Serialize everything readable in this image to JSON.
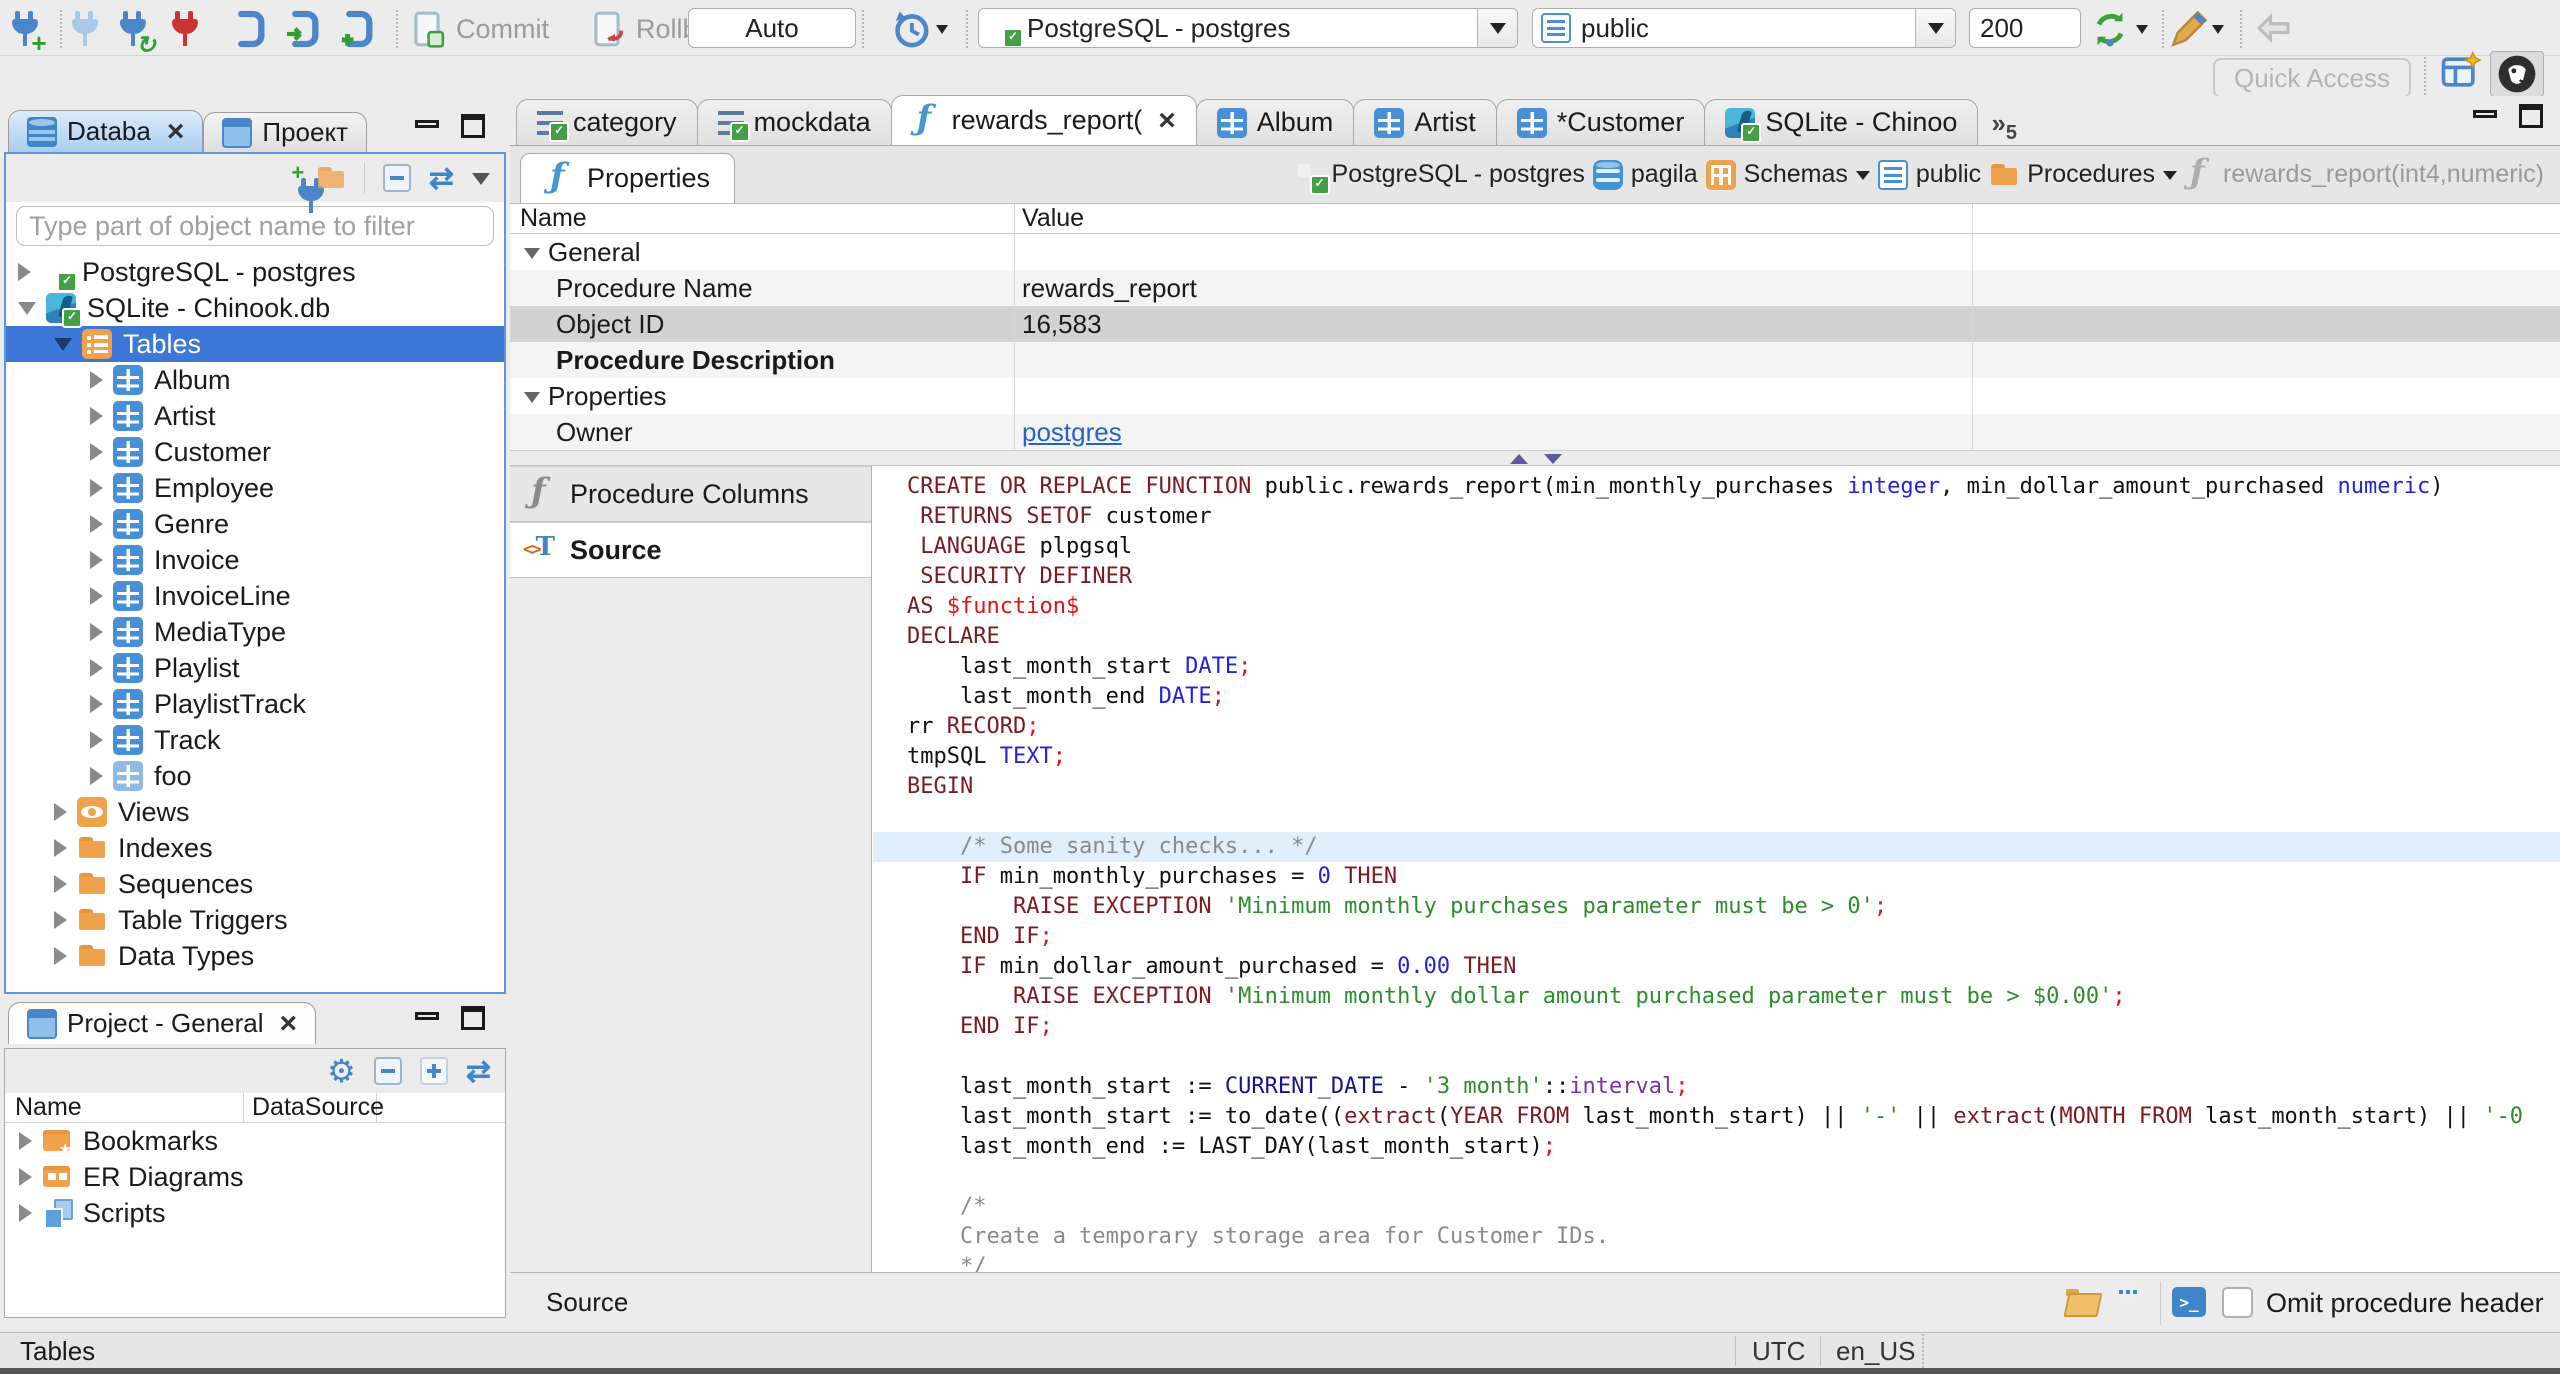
{
  "toolbar": {
    "commit": "Commit",
    "rollback": "Rollback",
    "auto": "Auto",
    "connection": "PostgreSQL - postgres",
    "schema": "public",
    "fetch_size": "200",
    "quick_access": "Quick Access"
  },
  "navigator": {
    "tab_database": "Databa",
    "tab_project": "Проект",
    "filter_placeholder": "Type part of object name to filter",
    "tree": [
      {
        "label": "PostgreSQL - postgres",
        "icon": "pg",
        "level": 0,
        "tw": "r"
      },
      {
        "label": "SQLite - Chinook.db",
        "icon": "sqlite",
        "level": 0,
        "tw": "d"
      },
      {
        "label": "Tables",
        "icon": "tables",
        "level": 1,
        "tw": "d",
        "sel": true
      },
      {
        "label": "Album",
        "icon": "table",
        "level": 2,
        "tw": "r"
      },
      {
        "label": "Artist",
        "icon": "table",
        "level": 2,
        "tw": "r"
      },
      {
        "label": "Customer",
        "icon": "table",
        "level": 2,
        "tw": "r"
      },
      {
        "label": "Employee",
        "icon": "table",
        "level": 2,
        "tw": "r"
      },
      {
        "label": "Genre",
        "icon": "table",
        "level": 2,
        "tw": "r"
      },
      {
        "label": "Invoice",
        "icon": "table",
        "level": 2,
        "tw": "r"
      },
      {
        "label": "InvoiceLine",
        "icon": "table",
        "level": 2,
        "tw": "r"
      },
      {
        "label": "MediaType",
        "icon": "table",
        "level": 2,
        "tw": "r"
      },
      {
        "label": "Playlist",
        "icon": "table",
        "level": 2,
        "tw": "r"
      },
      {
        "label": "PlaylistTrack",
        "icon": "table",
        "level": 2,
        "tw": "r"
      },
      {
        "label": "Track",
        "icon": "table",
        "level": 2,
        "tw": "r"
      },
      {
        "label": "foo",
        "icon": "table-light",
        "level": 2,
        "tw": "r"
      },
      {
        "label": "Views",
        "icon": "eye",
        "level": 1,
        "tw": "r"
      },
      {
        "label": "Indexes",
        "icon": "folder",
        "level": 1,
        "tw": "r"
      },
      {
        "label": "Sequences",
        "icon": "folder",
        "level": 1,
        "tw": "r"
      },
      {
        "label": "Table Triggers",
        "icon": "folder",
        "level": 1,
        "tw": "r"
      },
      {
        "label": "Data Types",
        "icon": "folder",
        "level": 1,
        "tw": "r"
      }
    ]
  },
  "project": {
    "tab": "Project - General",
    "col_name": "Name",
    "col_datasource": "DataSource",
    "tree": [
      {
        "label": "Bookmarks",
        "icon": "bookmarks"
      },
      {
        "label": "ER Diagrams",
        "icon": "erd"
      },
      {
        "label": "Scripts",
        "icon": "scripts"
      }
    ]
  },
  "editor": {
    "tabs": [
      {
        "label": "category",
        "icon": "script"
      },
      {
        "label": "mockdata",
        "icon": "script"
      },
      {
        "label": "rewards_report(",
        "icon": "fx",
        "active": true,
        "closable": true
      },
      {
        "label": "Album",
        "icon": "table"
      },
      {
        "label": "Artist",
        "icon": "table"
      },
      {
        "label": "*Customer",
        "icon": "table"
      },
      {
        "label": "SQLite - Chinoo",
        "icon": "sqlite"
      }
    ],
    "overflow": "5",
    "properties_tab": "Properties",
    "breadcrumb": [
      {
        "label": "PostgreSQL - postgres",
        "icon": "pg"
      },
      {
        "label": "pagila",
        "icon": "db"
      },
      {
        "label": "Schemas",
        "icon": "schemas",
        "caret": true
      },
      {
        "label": "public",
        "icon": "doc"
      },
      {
        "label": "Procedures",
        "icon": "folder",
        "caret": true
      },
      {
        "label": "rewards_report(int4,numeric)",
        "icon": "fx",
        "muted": true
      }
    ],
    "grid": {
      "col_name": "Name",
      "col_value": "Value",
      "rows": [
        {
          "name": "General",
          "group": true,
          "value": ""
        },
        {
          "name": "Procedure Name",
          "value": "rewards_report"
        },
        {
          "name": "Object ID",
          "value": "16,583",
          "selected": true
        },
        {
          "name": "Procedure Description",
          "bold": true,
          "value": ""
        },
        {
          "name": "Properties",
          "group": true,
          "value": ""
        },
        {
          "name": "Owner",
          "value": "postgres",
          "link": true
        }
      ]
    },
    "side_tabs": [
      {
        "label": "Procedure Columns",
        "icon": "fx gray"
      },
      {
        "label": "Source",
        "icon": "srct",
        "active": true
      }
    ],
    "footer": {
      "label": "Source",
      "omit": "Omit procedure header"
    }
  },
  "source_code": {
    "lines": [
      {
        "seg": [
          [
            "k",
            "CREATE OR REPLACE FUNCTION"
          ],
          [
            "p",
            " public.rewards_report(min_monthly_purchases "
          ],
          [
            "n",
            "integer"
          ],
          [
            "p",
            ", min_dollar_amount_purchased "
          ],
          [
            "n",
            "numeric"
          ],
          [
            "p",
            ")"
          ]
        ]
      },
      {
        "seg": [
          [
            "p",
            " "
          ],
          [
            "k",
            "RETURNS SETOF"
          ],
          [
            "p",
            " customer"
          ]
        ]
      },
      {
        "seg": [
          [
            "p",
            " "
          ],
          [
            "k",
            "LANGUAGE"
          ],
          [
            "p",
            " plpgsql"
          ]
        ]
      },
      {
        "seg": [
          [
            "p",
            " "
          ],
          [
            "k",
            "SECURITY DEFINER"
          ]
        ]
      },
      {
        "seg": [
          [
            "k",
            "AS"
          ],
          [
            "p",
            " "
          ],
          [
            "r",
            "$function$"
          ]
        ]
      },
      {
        "seg": [
          [
            "k",
            "DECLARE"
          ]
        ]
      },
      {
        "seg": [
          [
            "p",
            "    last_month_start "
          ],
          [
            "n",
            "DATE"
          ],
          [
            "r",
            ";"
          ]
        ]
      },
      {
        "seg": [
          [
            "p",
            "    last_month_end "
          ],
          [
            "n",
            "DATE"
          ],
          [
            "r",
            ";"
          ]
        ]
      },
      {
        "seg": [
          [
            "p",
            "rr "
          ],
          [
            "k",
            "RECORD"
          ],
          [
            "r",
            ";"
          ]
        ]
      },
      {
        "seg": [
          [
            "p",
            "tmpSQL "
          ],
          [
            "n",
            "TEXT"
          ],
          [
            "r",
            ";"
          ]
        ]
      },
      {
        "seg": [
          [
            "k",
            "BEGIN"
          ]
        ]
      },
      {
        "seg": []
      },
      {
        "hl": true,
        "seg": [
          [
            "c",
            "    /* Some sanity checks... */"
          ]
        ]
      },
      {
        "seg": [
          [
            "p",
            "    "
          ],
          [
            "k",
            "IF"
          ],
          [
            "p",
            " min_monthly_purchases = "
          ],
          [
            "n",
            "0"
          ],
          [
            "p",
            " "
          ],
          [
            "k",
            "THEN"
          ]
        ]
      },
      {
        "seg": [
          [
            "p",
            "        "
          ],
          [
            "k",
            "RAISE EXCEPTION"
          ],
          [
            "p",
            " "
          ],
          [
            "s",
            "'Minimum monthly purchases parameter must be > 0'"
          ],
          [
            "r",
            ";"
          ]
        ]
      },
      {
        "seg": [
          [
            "p",
            "    "
          ],
          [
            "k",
            "END IF"
          ],
          [
            "r",
            ";"
          ]
        ]
      },
      {
        "seg": [
          [
            "p",
            "    "
          ],
          [
            "k",
            "IF"
          ],
          [
            "p",
            " min_dollar_amount_purchased = "
          ],
          [
            "n",
            "0.00"
          ],
          [
            "p",
            " "
          ],
          [
            "k",
            "THEN"
          ]
        ]
      },
      {
        "seg": [
          [
            "p",
            "        "
          ],
          [
            "k",
            "RAISE EXCEPTION"
          ],
          [
            "p",
            " "
          ],
          [
            "s",
            "'Minimum monthly dollar amount purchased parameter must be > $0.00'"
          ],
          [
            "r",
            ";"
          ]
        ]
      },
      {
        "seg": [
          [
            "p",
            "    "
          ],
          [
            "k",
            "END IF"
          ],
          [
            "r",
            ";"
          ]
        ]
      },
      {
        "seg": []
      },
      {
        "seg": [
          [
            "p",
            "    last_month_start := "
          ],
          [
            "v",
            "CURRENT_DATE"
          ],
          [
            "p",
            " - "
          ],
          [
            "s",
            "'3 month'"
          ],
          [
            "p",
            "::"
          ],
          [
            "i",
            "interval"
          ],
          [
            "r",
            ";"
          ]
        ]
      },
      {
        "seg": [
          [
            "p",
            "    last_month_start := to_date(("
          ],
          [
            "k",
            "extract"
          ],
          [
            "p",
            "("
          ],
          [
            "k",
            "YEAR FROM"
          ],
          [
            "p",
            " last_month_start) || "
          ],
          [
            "s",
            "'-'"
          ],
          [
            "p",
            " || "
          ],
          [
            "k",
            "extract"
          ],
          [
            "p",
            "("
          ],
          [
            "k",
            "MONTH FROM"
          ],
          [
            "p",
            " last_month_start) || "
          ],
          [
            "s",
            "'-0"
          ]
        ]
      },
      {
        "seg": [
          [
            "p",
            "    last_month_end := LAST_DAY(last_month_start)"
          ],
          [
            "r",
            ";"
          ]
        ]
      },
      {
        "seg": []
      },
      {
        "seg": [
          [
            "c",
            "    /*"
          ]
        ]
      },
      {
        "seg": [
          [
            "c",
            "    Create a temporary storage area for Customer IDs."
          ]
        ]
      },
      {
        "seg": [
          [
            "c",
            "    */"
          ]
        ]
      }
    ]
  },
  "statusbar": {
    "left": "Tables",
    "tz": "UTC",
    "locale": "en_US"
  }
}
